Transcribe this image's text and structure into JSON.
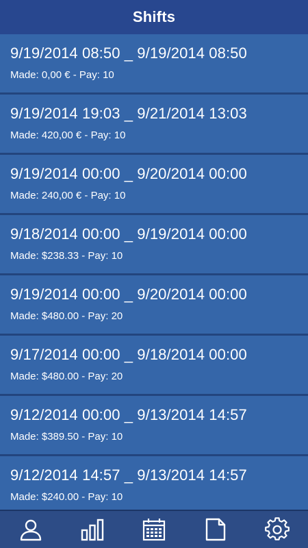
{
  "header": {
    "title": "Shifts"
  },
  "shifts": [
    {
      "range": "9/19/2014 08:50 _ 9/19/2014 08:50",
      "detail": "Made: 0,00 € - Pay: 10"
    },
    {
      "range": "9/19/2014 19:03 _ 9/21/2014 13:03",
      "detail": "Made: 420,00 € - Pay: 10"
    },
    {
      "range": "9/19/2014 00:00 _ 9/20/2014 00:00",
      "detail": "Made: 240,00 € - Pay: 10"
    },
    {
      "range": "9/18/2014 00:00 _ 9/19/2014 00:00",
      "detail": "Made: $238.33 - Pay: 10"
    },
    {
      "range": "9/19/2014 00:00 _ 9/20/2014 00:00",
      "detail": "Made: $480.00 - Pay: 20"
    },
    {
      "range": "9/17/2014 00:00 _ 9/18/2014 00:00",
      "detail": "Made: $480.00 - Pay: 20"
    },
    {
      "range": "9/12/2014 00:00 _ 9/13/2014 14:57",
      "detail": "Made: $389.50 - Pay: 10"
    },
    {
      "range": "9/12/2014 14:57 _ 9/13/2014 14:57",
      "detail": "Made: $240.00 - Pay: 10"
    }
  ],
  "tabbar": {
    "tabs": [
      {
        "icon": "person-icon"
      },
      {
        "icon": "bar-chart-icon"
      },
      {
        "icon": "calendar-icon"
      },
      {
        "icon": "document-icon"
      },
      {
        "icon": "gear-icon"
      }
    ]
  },
  "colors": {
    "header_bg": "#28478f",
    "item_bg": "#3566a9",
    "divider": "#23457e",
    "tabbar_bg": "#2d4c86",
    "text": "#ffffff"
  }
}
